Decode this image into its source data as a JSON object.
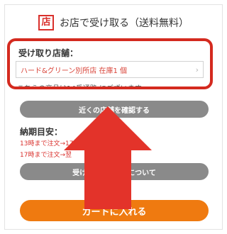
{
  "header": {
    "icon_char": "店",
    "title": "お店で受け取る（送料無料）"
  },
  "store": {
    "label": "受け取り店舗：",
    "selected": "ハード&グリーン別所店 在庫1 個",
    "note": "こちらの商品は14番通路 にございます"
  },
  "buttons": {
    "nearby_stores": "近くの店舗を確認する",
    "shipping_prefix": "受け取",
    "shipping_suffix": "料について",
    "add_to_cart": "カートに入れる"
  },
  "delivery": {
    "title": "納期目安：",
    "line1": "13時まで注文→17時ま",
    "line2": "17時まで注文→翌"
  },
  "colors": {
    "highlight_red": "#d42a1f",
    "arrow_red": "#e3332a",
    "cart_orange": "#ef7a10",
    "button_gray": "#8a8a8a"
  },
  "icons": {
    "store": "store-icon",
    "chevron": "chevron-right-icon",
    "arrow": "up-arrow-icon"
  }
}
